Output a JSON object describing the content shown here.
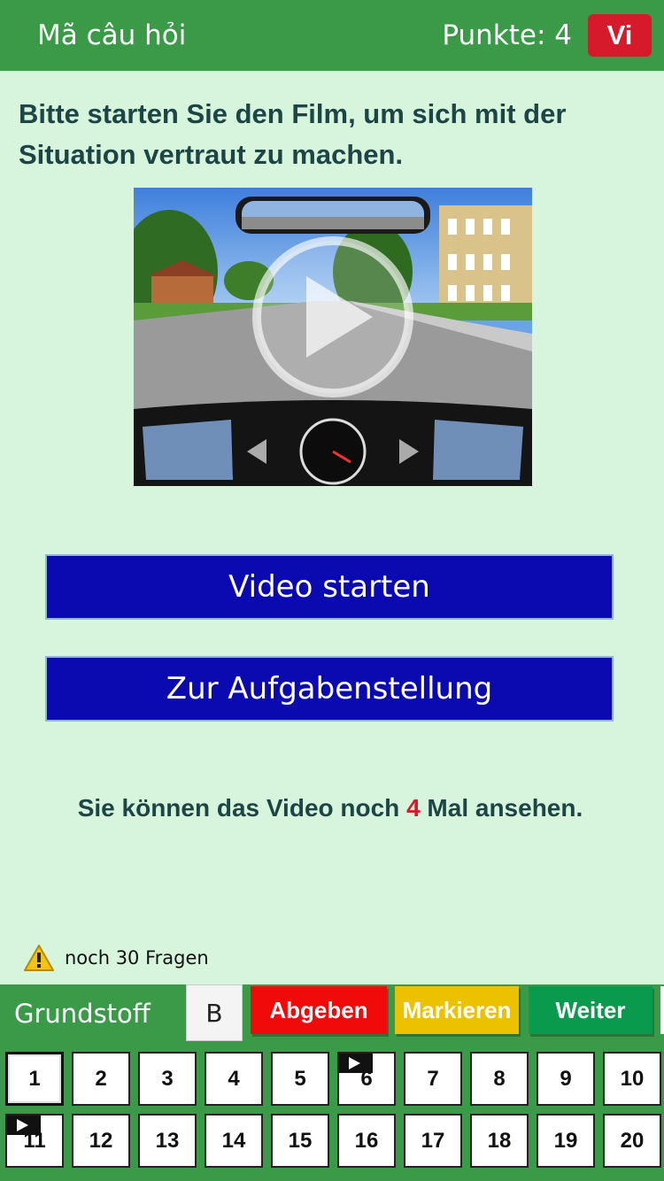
{
  "header": {
    "title": "Mã câu hỏi",
    "points_label": "Punkte: 4",
    "language_button": "Vi"
  },
  "question": {
    "text": "Bitte starten Sie den Film, um sich mit der Situation vertraut zu machen."
  },
  "video": {
    "play_icon": "play-icon"
  },
  "buttons": {
    "start_video": "Video starten",
    "to_task": "Zur Aufgabenstellung"
  },
  "note": {
    "prefix": "Sie können das Video noch ",
    "count": "4",
    "suffix": " Mal ansehen."
  },
  "remaining": {
    "icon": "warning-icon",
    "text": "noch 30 Fragen"
  },
  "footer": {
    "category": "Grundstoff",
    "class_label": "B",
    "submit": "Abgeben",
    "mark": "Markieren",
    "next": "Weiter"
  },
  "colors": {
    "header_green": "#3a9a48",
    "background": "#d6f5dc",
    "button_blue": "#0a0ab0",
    "submit_red": "#f00a0a",
    "mark_yellow": "#ebc100",
    "next_green": "#0a9a4d",
    "accent_red": "#d6192b"
  },
  "question_numbers": [
    {
      "label": "1",
      "active": true,
      "video": false
    },
    {
      "label": "2",
      "active": false,
      "video": false
    },
    {
      "label": "3",
      "active": false,
      "video": false
    },
    {
      "label": "4",
      "active": false,
      "video": false
    },
    {
      "label": "5",
      "active": false,
      "video": false
    },
    {
      "label": "6",
      "active": false,
      "video": true
    },
    {
      "label": "7",
      "active": false,
      "video": false
    },
    {
      "label": "8",
      "active": false,
      "video": false
    },
    {
      "label": "9",
      "active": false,
      "video": false
    },
    {
      "label": "10",
      "active": false,
      "video": false
    },
    {
      "label": "11",
      "active": false,
      "video": true
    },
    {
      "label": "12",
      "active": false,
      "video": false
    },
    {
      "label": "13",
      "active": false,
      "video": false
    },
    {
      "label": "14",
      "active": false,
      "video": false
    },
    {
      "label": "15",
      "active": false,
      "video": false
    },
    {
      "label": "16",
      "active": false,
      "video": false
    },
    {
      "label": "17",
      "active": false,
      "video": false
    },
    {
      "label": "18",
      "active": false,
      "video": false
    },
    {
      "label": "19",
      "active": false,
      "video": false
    },
    {
      "label": "20",
      "active": false,
      "video": false
    }
  ]
}
